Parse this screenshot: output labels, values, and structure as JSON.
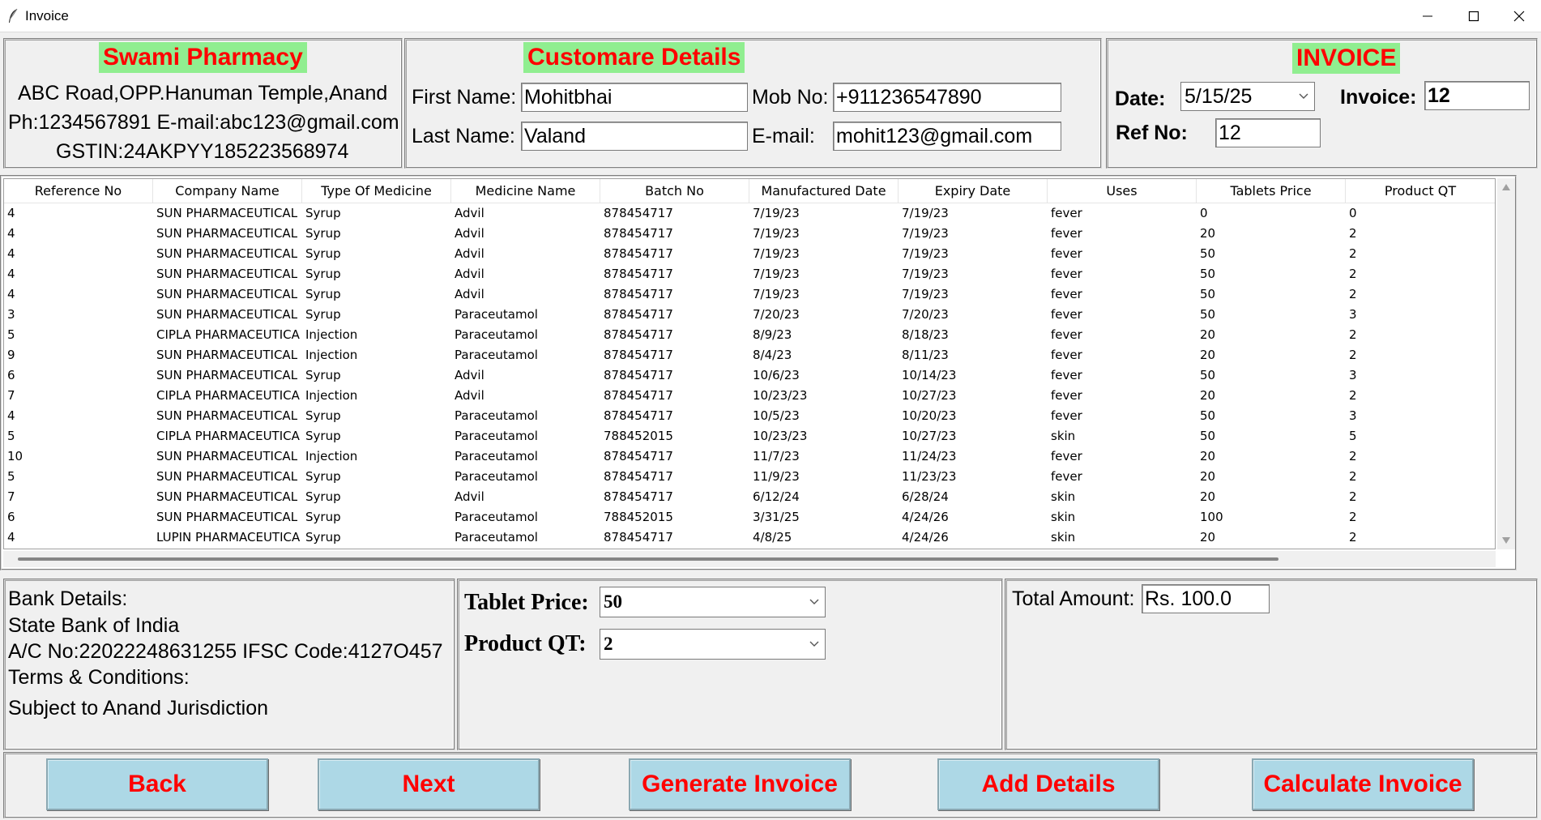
{
  "window": {
    "title": "Invoice"
  },
  "pharmacy": {
    "name": "Swami Pharmacy",
    "address": "ABC Road,OPP.Hanuman Temple,Anand",
    "contact": "Ph:1234567891 E-mail:abc123@gmail.com",
    "gstin": "GSTIN:24AKPYY185223568974"
  },
  "customer": {
    "heading": "Customare Details",
    "first_name_label": "First Name:",
    "first_name": "Mohitbhai",
    "last_name_label": "Last Name:",
    "last_name": "Valand",
    "mob_label": "Mob No:",
    "mob": "+911236547890",
    "email_label": "E-mail:",
    "email": "mohit123@gmail.com"
  },
  "invoice": {
    "heading": "INVOICE",
    "date_label": "Date:",
    "date": "5/15/25",
    "invoice_label": "Invoice:",
    "invoice_no": "12",
    "ref_label": "Ref No:",
    "ref_no": "12"
  },
  "table": {
    "columns": [
      "Reference No",
      "Company Name",
      "Type Of Medicine",
      "Medicine Name",
      "Batch No",
      "Manufactured Date",
      "Expiry Date",
      "Uses",
      "Tablets Price",
      "Product QT"
    ],
    "rows": [
      [
        "4",
        "SUN PHARMACEUTICAL",
        "Syrup",
        "Advil",
        "878454717",
        "7/19/23",
        "7/19/23",
        "fever",
        "0",
        "0"
      ],
      [
        "4",
        "SUN PHARMACEUTICAL",
        "Syrup",
        "Advil",
        "878454717",
        "7/19/23",
        "7/19/23",
        "fever",
        "20",
        "2"
      ],
      [
        "4",
        "SUN PHARMACEUTICAL",
        "Syrup",
        "Advil",
        "878454717",
        "7/19/23",
        "7/19/23",
        "fever",
        "50",
        "2"
      ],
      [
        "4",
        "SUN PHARMACEUTICAL",
        "Syrup",
        "Advil",
        "878454717",
        "7/19/23",
        "7/19/23",
        "fever",
        "50",
        "2"
      ],
      [
        "4",
        "SUN PHARMACEUTICAL",
        "Syrup",
        "Advil",
        "878454717",
        "7/19/23",
        "7/19/23",
        "fever",
        "50",
        "2"
      ],
      [
        "3",
        "SUN PHARMACEUTICAL",
        "Syrup",
        "Paraceutamol",
        "878454717",
        "7/20/23",
        "7/20/23",
        "fever",
        "50",
        "3"
      ],
      [
        "5",
        "CIPLA PHARMACEUTICA",
        "Injection",
        "Paraceutamol",
        "878454717",
        "8/9/23",
        "8/18/23",
        "fever",
        "20",
        "2"
      ],
      [
        "9",
        "SUN PHARMACEUTICAL",
        "Injection",
        "Paraceutamol",
        "878454717",
        "8/4/23",
        "8/11/23",
        "fever",
        "20",
        "2"
      ],
      [
        "6",
        "SUN PHARMACEUTICAL",
        "Syrup",
        "Advil",
        "878454717",
        "10/6/23",
        "10/14/23",
        "fever",
        "50",
        "3"
      ],
      [
        "7",
        "CIPLA PHARMACEUTICA",
        "Injection",
        "Advil",
        "878454717",
        "10/23/23",
        "10/27/23",
        "fever",
        "20",
        "2"
      ],
      [
        "4",
        "SUN PHARMACEUTICAL",
        "Syrup",
        "Paraceutamol",
        "878454717",
        "10/5/23",
        "10/20/23",
        "fever",
        "50",
        "3"
      ],
      [
        "5",
        "CIPLA PHARMACEUTICA",
        "Syrup",
        "Paraceutamol",
        "788452015",
        "10/23/23",
        "10/27/23",
        "skin",
        "50",
        "5"
      ],
      [
        "10",
        "SUN PHARMACEUTICAL",
        "Injection",
        "Paraceutamol",
        "878454717",
        "11/7/23",
        "11/24/23",
        "fever",
        "20",
        "2"
      ],
      [
        "5",
        "SUN PHARMACEUTICAL",
        "Syrup",
        "Paraceutamol",
        "878454717",
        "11/9/23",
        "11/23/23",
        "fever",
        "20",
        "2"
      ],
      [
        "7",
        "SUN PHARMACEUTICAL",
        "Syrup",
        "Advil",
        "878454717",
        "6/12/24",
        "6/28/24",
        "skin",
        "20",
        "2"
      ],
      [
        "6",
        "SUN PHARMACEUTICAL",
        "Syrup",
        "Paraceutamol",
        "788452015",
        "3/31/25",
        "4/24/26",
        "skin",
        "100",
        "2"
      ],
      [
        "4",
        "LUPIN PHARMACEUTICA",
        "Syrup",
        "Paraceutamol",
        "878454717",
        "4/8/25",
        "4/24/26",
        "skin",
        "20",
        "2"
      ]
    ]
  },
  "bank": {
    "title": "Bank Details:",
    "bank_name": "State Bank of India",
    "account": "A/C No:22022248631255  IFSC Code:4127O457",
    "terms_title": "Terms & Conditions:",
    "terms": "Subject to Anand Jurisdiction"
  },
  "calc": {
    "tablet_price_label": "Tablet Price:",
    "tablet_price": "50",
    "product_qt_label": "Product QT:",
    "product_qt": "2"
  },
  "total": {
    "label": "Total Amount:",
    "value": "Rs. 100.0"
  },
  "buttons": {
    "back": "Back",
    "next": "Next",
    "generate": "Generate Invoice",
    "add": "Add Details",
    "calculate": "Calculate Invoice"
  },
  "colors": {
    "heading_bg": "#90ee90",
    "heading_text": "#ff0000",
    "button_bg": "#add8e6",
    "button_text": "#ff0000"
  },
  "icons": {
    "app": "feather-icon",
    "minimize": "minimize-icon",
    "maximize": "maximize-icon",
    "close": "close-icon"
  }
}
